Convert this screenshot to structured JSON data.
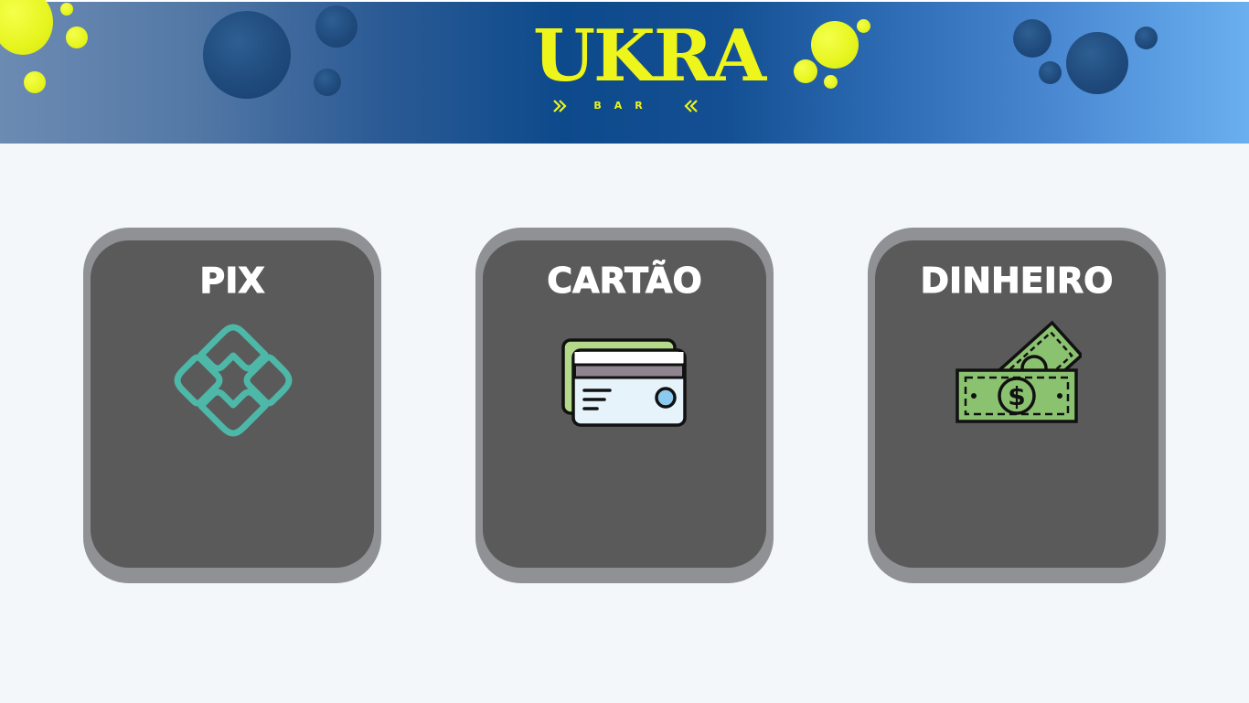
{
  "header": {
    "logo_text": "UKRA",
    "logo_subtitle": "BAR",
    "colors": {
      "logo": "#eef51a",
      "header_left": "#6c8bb3",
      "header_mid": "#0d4a8c",
      "header_right": "#6aafef"
    }
  },
  "payment_options": [
    {
      "title": "PIX",
      "icon": "pix-icon"
    },
    {
      "title": "CARTÃO",
      "icon": "credit-card-icon"
    },
    {
      "title": "DINHEIRO",
      "icon": "cash-icon"
    }
  ],
  "colors": {
    "background": "#f3f7fa",
    "card_outer": "#8f9194",
    "card_inner": "#5a5a5a",
    "pix": "#4db8a8",
    "cash": "#8bc270"
  }
}
